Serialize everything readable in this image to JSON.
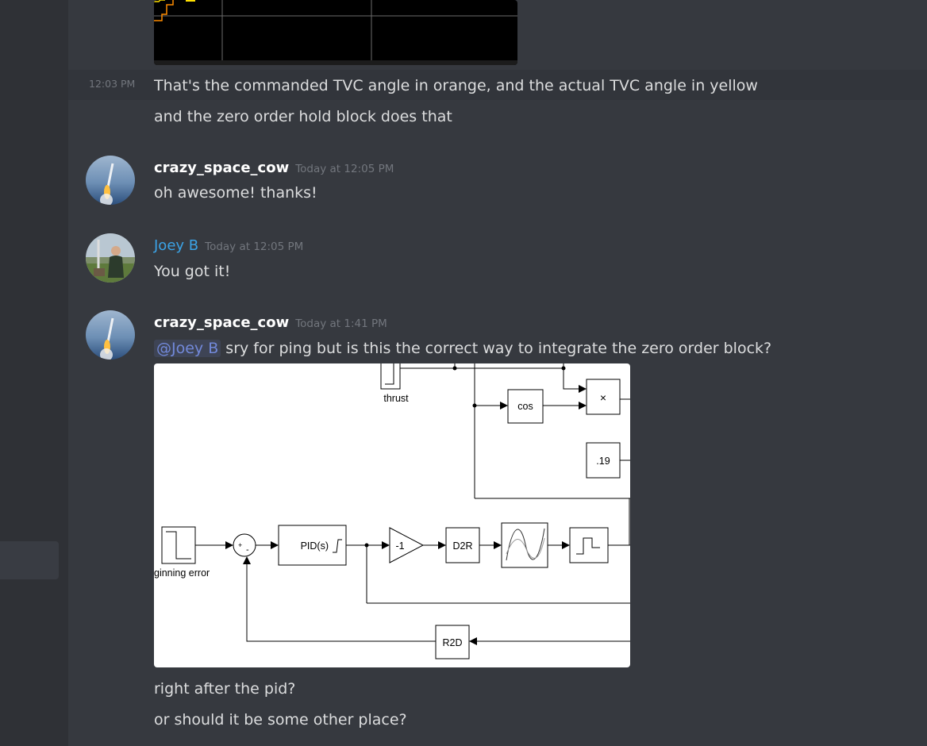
{
  "messages": {
    "m0": {
      "time": "12:03 PM",
      "text": "That's the commanded TVC angle in orange, and the actual TVC angle in yellow"
    },
    "m1": {
      "text": "and the zero order hold block does that"
    },
    "m2": {
      "author": "crazy_space_cow",
      "timestamp": "Today at 12:05 PM",
      "text": "oh awesome! thanks!",
      "author_color": "#ffffff"
    },
    "m3": {
      "author": "Joey B",
      "timestamp": "Today at 12:05 PM",
      "text": "You got it!",
      "author_color": "#3ba3e6"
    },
    "m4": {
      "author": "crazy_space_cow",
      "timestamp": "Today at 1:41 PM",
      "mention": "@Joey B",
      "text": "sry for ping but is this the correct way to integrate the zero order block?"
    },
    "m5": {
      "text": "right after the pid?"
    },
    "m6": {
      "text": "or should it be some other place?"
    }
  },
  "diagram": {
    "thrust_label": "thrust",
    "cos_label": "cos",
    "mult_label": "×",
    "const_label": ".19",
    "pid_label": "PID(s)",
    "gain_label": "-1",
    "d2r_label": "D2R",
    "r2d_label": "R2D",
    "step_label": "ginning error",
    "sum_plus": "+",
    "sum_minus": "-"
  },
  "colors": {
    "background": "#36393f",
    "sidebar": "#2f3136",
    "text": "#dcddde",
    "timestamp": "#72767d",
    "joey": "#3ba3e6",
    "mention": "#7289da",
    "plot_orange": "#ff8c00",
    "plot_yellow": "#ffe000"
  }
}
